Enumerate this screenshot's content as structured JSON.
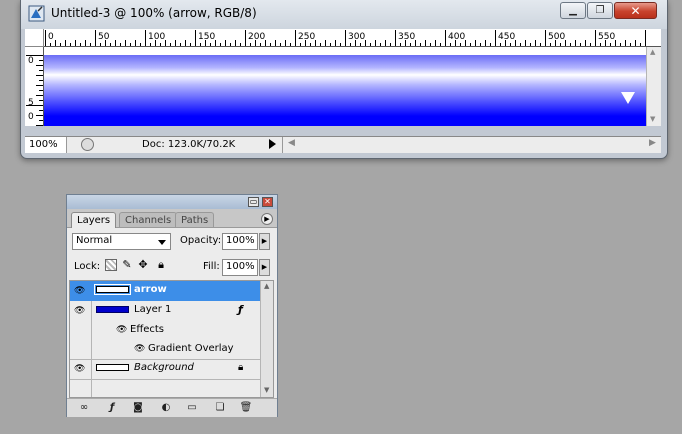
{
  "document_window": {
    "title": "Untitled-3 @ 100% (arrow, RGB/8)",
    "zoom": "100%",
    "doc_info": "Doc: 123.0K/70.2K",
    "ruler_labels": [
      "0",
      "50",
      "100",
      "150",
      "200",
      "250",
      "300",
      "350",
      "400",
      "450",
      "500",
      "550"
    ],
    "v_ruler_labels": [
      "0",
      "5",
      "0"
    ],
    "gradient_colors": [
      "#6a6cf5",
      "#ffffff",
      "#0000ff"
    ]
  },
  "layers_panel": {
    "tabs": [
      "Layers",
      "Channels",
      "Paths"
    ],
    "blend_mode": "Normal",
    "opacity_label": "Opacity:",
    "opacity_value": "100%",
    "lock_label": "Lock:",
    "fill_label": "Fill:",
    "fill_value": "100%",
    "layers": [
      {
        "name": "arrow",
        "selected": true
      },
      {
        "name": "Layer 1",
        "thumb_color": "#0000cc"
      },
      {
        "name": "Effects"
      },
      {
        "name": "Gradient Overlay"
      },
      {
        "name": "Background",
        "locked": true
      }
    ],
    "selection_color": "#3d8ee8"
  }
}
